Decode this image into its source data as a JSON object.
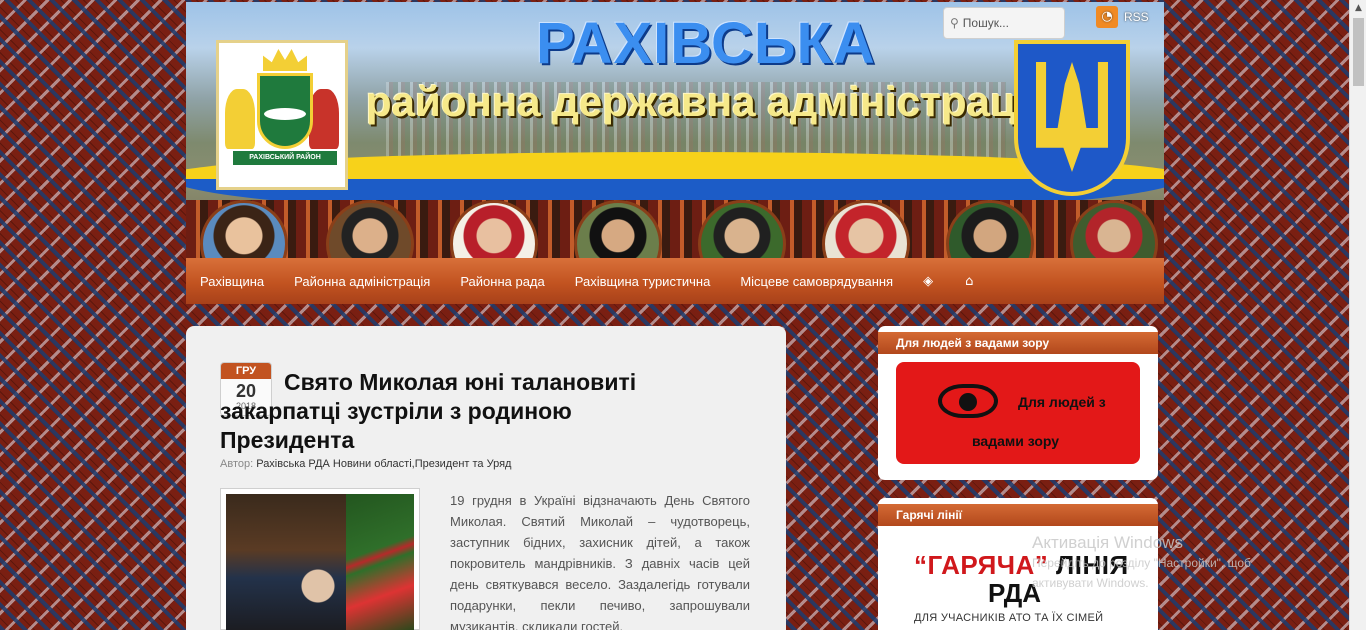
{
  "header": {
    "title_line1": "РАХІВСЬКА",
    "title_line2": "районна державна адміністрація",
    "crest_ribbon": "РАХІВСЬКИЙ РАЙОН",
    "rss_label": "RSS",
    "search_placeholder": "Пошук..."
  },
  "nav": {
    "items": [
      "Рахівщина",
      "Районна адміністрація",
      "Районна рада",
      "Рахівщина туристична",
      "Місцеве самоврядування"
    ],
    "icons": [
      "eye-icon",
      "home-icon"
    ]
  },
  "post": {
    "date_month": "ГРУ",
    "date_day": "20",
    "date_year": "2018",
    "title": "Свято Миколая юні талановиті закарпатці зустріли з родиною Президента",
    "meta_label": "Автор:",
    "meta_author": "Рахівська РДА",
    "meta_categories": "Новини області,Президент та Уряд",
    "body": "19 грудня в Україні відзначають День Святого Миколая. Святий Миколай – чудотворець, заступник бідних, захисник дітей, а також покровитель мандрівників. З давніх часів цей день святкувався весело. Заздалегідь готували подарунки, пекли печиво, запрошували музикантів, скликали гостей."
  },
  "sidebar": {
    "vision_widget_title": "Для людей з вадами зору",
    "vision_button_line1": "Для людей з",
    "vision_button_line2": "вадами зору",
    "hotline_widget_title": "Гарячі лінії",
    "hotline_quote": "“ГАРЯЧА”",
    "hotline_word": "ЛІНІЯ",
    "hotline_rda": "РДА",
    "hotline_sub": "ДЛЯ УЧАСНИКІВ АТО ТА ЇХ СІМЕЙ"
  },
  "os_watermark": {
    "line1": "Активація Windows",
    "line2": "Перейдіть до розділу \"Настройки\", щоб",
    "line3": "активувати Windows."
  },
  "colors": {
    "nav_orange": "#c25320",
    "accent_red": "#e31818"
  }
}
